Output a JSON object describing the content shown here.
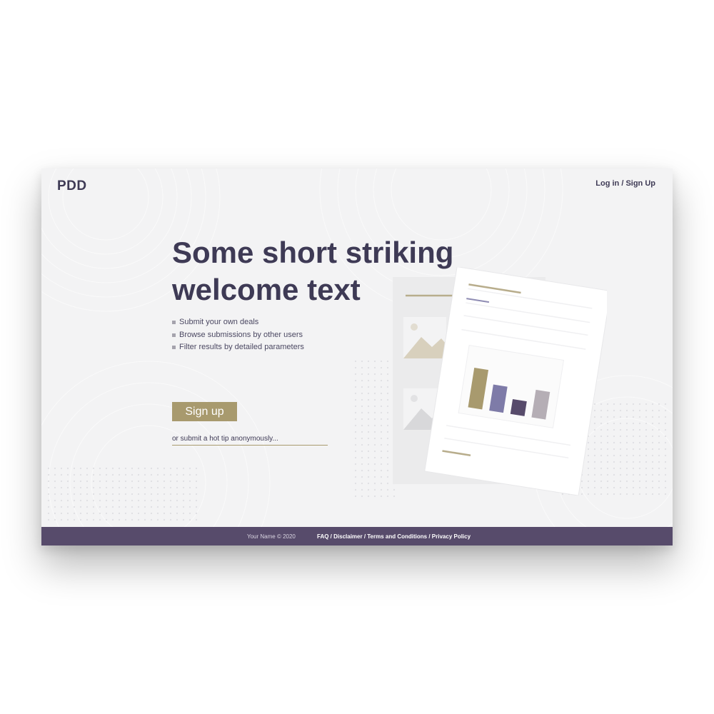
{
  "header": {
    "logo": "PDD",
    "auth_link": "Log in / Sign Up"
  },
  "hero": {
    "headline": "Some short striking welcome text",
    "features": [
      "Submit your own deals",
      "Browse submissions by other users",
      "Filter results by detailed parameters"
    ],
    "signup_label": "Sign up",
    "tip_link": "or submit a hot tip anonymously..."
  },
  "illustration": {
    "bar_values": [
      0.56,
      0.37,
      0.21,
      0.39
    ],
    "bar_colors": [
      "#a89a6e",
      "#7e7ba8",
      "#574b6b",
      "#b5aeb5"
    ]
  },
  "footer": {
    "copyright": "Your Name © 2020",
    "links": [
      "FAQ",
      "Disclaimer",
      "Terms and Conditions",
      "Privacy Policy"
    ],
    "separator": " / "
  },
  "colors": {
    "brand_dark": "#3e3a55",
    "accent_gold": "#a89a6e",
    "footer_bg": "#574b6b",
    "page_bg": "#f3f3f4"
  }
}
